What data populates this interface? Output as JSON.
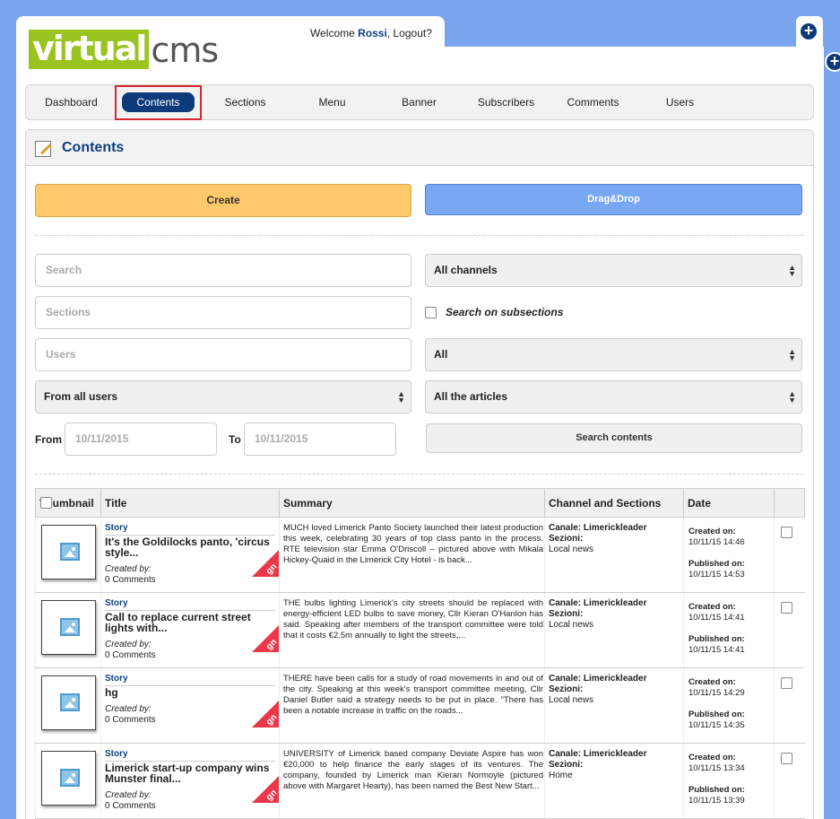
{
  "header": {
    "logo": {
      "virtual": "virtual",
      "cms": "cms"
    },
    "welcome": {
      "prefix": "Welcome ",
      "user": "Rossi",
      "suffix": ", Logout?"
    }
  },
  "nav": {
    "items": [
      {
        "label": "Dashboard",
        "active": false
      },
      {
        "label": "Contents",
        "active": true
      },
      {
        "label": "Sections",
        "active": false
      },
      {
        "label": "Menu",
        "active": false
      },
      {
        "label": "Banner",
        "active": false
      },
      {
        "label": "Subscribers",
        "active": false
      },
      {
        "label": "Comments",
        "active": false
      },
      {
        "label": "Users",
        "active": false
      }
    ]
  },
  "panel": {
    "title": "Contents"
  },
  "actions": {
    "create": "Create",
    "dragdrop": "Drag&Drop"
  },
  "filters": {
    "search_placeholder": "Search",
    "sections_placeholder": "Sections",
    "users_placeholder": "Users",
    "user_scope": "From all users",
    "channels": "All channels",
    "subsections_label": "Search on subsections",
    "status": "All",
    "articles": "All the articles",
    "from_label": "From",
    "from_value": "10/11/2015",
    "to_label": "To",
    "to_value": "10/11/2015",
    "search_button": "Search contents"
  },
  "table": {
    "columns": [
      "Thumbnail",
      "Title",
      "Summary",
      "Channel and Sections",
      "Date"
    ],
    "rows": [
      {
        "type": "Story",
        "title": "It's the Goldilocks panto, 'circus style...",
        "created_by": "Created by:",
        "comments": "0 Comments",
        "badge": "gn",
        "summary": "MUCH loved Limerick Panto Society launched their latest production this week, celebrating 30 years of top class panto in the process. RTE television star Emma O'Driscoll – pictured above with Mikala Hickey-Quaid in the Limerick City Hotel - is back...",
        "canale": "Canale: Limerickleader",
        "sezioni": "Sezioni:",
        "section": "Local news",
        "created_label": "Created on:",
        "created": "10/11/15 14:46",
        "published_label": "Published on:",
        "published": "10/11/15 14:53"
      },
      {
        "type": "Story",
        "title": "Call to replace current street lights with...",
        "created_by": "Created by:",
        "comments": "0 Comments",
        "badge": "gn",
        "summary": "THE bulbs lighting Limerick's city streets should be replaced with energy-efficient LED bulbs to save money, Cllr Kieran O'Hanlon has said. Speaking after members of the transport committee were told that it costs €2.5m annually to light the streets,...",
        "canale": "Canale: Limerickleader",
        "sezioni": "Sezioni:",
        "section": "Local news",
        "created_label": "Created on:",
        "created": "10/11/15 14:41",
        "published_label": "Published on:",
        "published": "10/11/15 14:41"
      },
      {
        "type": "Story",
        "title": "hg",
        "created_by": "Created by:",
        "comments": "0 Comments",
        "badge": "gn",
        "summary": "THERE have been calls for a study of road movements in and out of the city. Speaking at this week's transport committee meeting, Cllr Daniel Butler said a strategy needs to be put in place. \"There has been a notable increase in traffic on the roads...",
        "canale": "Canale: Limerickleader",
        "sezioni": "Sezioni:",
        "section": "Local news",
        "created_label": "Created on:",
        "created": "10/11/15 14:29",
        "published_label": "Published on:",
        "published": "10/11/15 14:35"
      },
      {
        "type": "Story",
        "title": "Limerick start-up company wins Munster final...",
        "created_by": "Created by:",
        "comments": "0 Comments",
        "badge": "gn",
        "summary": "UNIVERSITY of Limerick based company Deviate Aspire has won €20,000 to help finance the early stages of its ventures. The company, founded by Limerick man Kieran Normoyle (pictured above with Margaret Hearty), has been named the Best New Start...",
        "canale": "Canale: Limerickleader",
        "sezioni": "Sezioni:",
        "section": "Home",
        "created_label": "Created on:",
        "created": "10/11/15 13:34",
        "published_label": "Published on:",
        "published": "10/11/15 13:39"
      }
    ]
  }
}
